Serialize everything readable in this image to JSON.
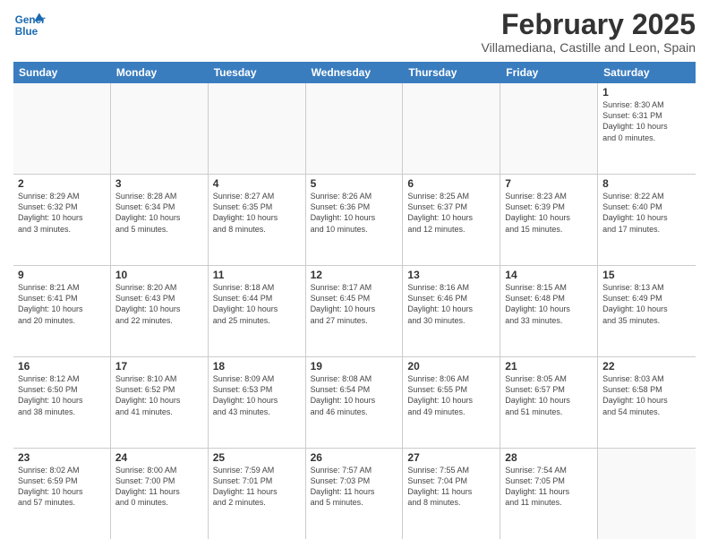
{
  "header": {
    "logo_text_general": "General",
    "logo_text_blue": "Blue",
    "month_title": "February 2025",
    "subtitle": "Villamediana, Castille and Leon, Spain"
  },
  "days_of_week": [
    "Sunday",
    "Monday",
    "Tuesday",
    "Wednesday",
    "Thursday",
    "Friday",
    "Saturday"
  ],
  "weeks": [
    [
      {
        "day": "",
        "info": ""
      },
      {
        "day": "",
        "info": ""
      },
      {
        "day": "",
        "info": ""
      },
      {
        "day": "",
        "info": ""
      },
      {
        "day": "",
        "info": ""
      },
      {
        "day": "",
        "info": ""
      },
      {
        "day": "1",
        "info": "Sunrise: 8:30 AM\nSunset: 6:31 PM\nDaylight: 10 hours\nand 0 minutes."
      }
    ],
    [
      {
        "day": "2",
        "info": "Sunrise: 8:29 AM\nSunset: 6:32 PM\nDaylight: 10 hours\nand 3 minutes."
      },
      {
        "day": "3",
        "info": "Sunrise: 8:28 AM\nSunset: 6:34 PM\nDaylight: 10 hours\nand 5 minutes."
      },
      {
        "day": "4",
        "info": "Sunrise: 8:27 AM\nSunset: 6:35 PM\nDaylight: 10 hours\nand 8 minutes."
      },
      {
        "day": "5",
        "info": "Sunrise: 8:26 AM\nSunset: 6:36 PM\nDaylight: 10 hours\nand 10 minutes."
      },
      {
        "day": "6",
        "info": "Sunrise: 8:25 AM\nSunset: 6:37 PM\nDaylight: 10 hours\nand 12 minutes."
      },
      {
        "day": "7",
        "info": "Sunrise: 8:23 AM\nSunset: 6:39 PM\nDaylight: 10 hours\nand 15 minutes."
      },
      {
        "day": "8",
        "info": "Sunrise: 8:22 AM\nSunset: 6:40 PM\nDaylight: 10 hours\nand 17 minutes."
      }
    ],
    [
      {
        "day": "9",
        "info": "Sunrise: 8:21 AM\nSunset: 6:41 PM\nDaylight: 10 hours\nand 20 minutes."
      },
      {
        "day": "10",
        "info": "Sunrise: 8:20 AM\nSunset: 6:43 PM\nDaylight: 10 hours\nand 22 minutes."
      },
      {
        "day": "11",
        "info": "Sunrise: 8:18 AM\nSunset: 6:44 PM\nDaylight: 10 hours\nand 25 minutes."
      },
      {
        "day": "12",
        "info": "Sunrise: 8:17 AM\nSunset: 6:45 PM\nDaylight: 10 hours\nand 27 minutes."
      },
      {
        "day": "13",
        "info": "Sunrise: 8:16 AM\nSunset: 6:46 PM\nDaylight: 10 hours\nand 30 minutes."
      },
      {
        "day": "14",
        "info": "Sunrise: 8:15 AM\nSunset: 6:48 PM\nDaylight: 10 hours\nand 33 minutes."
      },
      {
        "day": "15",
        "info": "Sunrise: 8:13 AM\nSunset: 6:49 PM\nDaylight: 10 hours\nand 35 minutes."
      }
    ],
    [
      {
        "day": "16",
        "info": "Sunrise: 8:12 AM\nSunset: 6:50 PM\nDaylight: 10 hours\nand 38 minutes."
      },
      {
        "day": "17",
        "info": "Sunrise: 8:10 AM\nSunset: 6:52 PM\nDaylight: 10 hours\nand 41 minutes."
      },
      {
        "day": "18",
        "info": "Sunrise: 8:09 AM\nSunset: 6:53 PM\nDaylight: 10 hours\nand 43 minutes."
      },
      {
        "day": "19",
        "info": "Sunrise: 8:08 AM\nSunset: 6:54 PM\nDaylight: 10 hours\nand 46 minutes."
      },
      {
        "day": "20",
        "info": "Sunrise: 8:06 AM\nSunset: 6:55 PM\nDaylight: 10 hours\nand 49 minutes."
      },
      {
        "day": "21",
        "info": "Sunrise: 8:05 AM\nSunset: 6:57 PM\nDaylight: 10 hours\nand 51 minutes."
      },
      {
        "day": "22",
        "info": "Sunrise: 8:03 AM\nSunset: 6:58 PM\nDaylight: 10 hours\nand 54 minutes."
      }
    ],
    [
      {
        "day": "23",
        "info": "Sunrise: 8:02 AM\nSunset: 6:59 PM\nDaylight: 10 hours\nand 57 minutes."
      },
      {
        "day": "24",
        "info": "Sunrise: 8:00 AM\nSunset: 7:00 PM\nDaylight: 11 hours\nand 0 minutes."
      },
      {
        "day": "25",
        "info": "Sunrise: 7:59 AM\nSunset: 7:01 PM\nDaylight: 11 hours\nand 2 minutes."
      },
      {
        "day": "26",
        "info": "Sunrise: 7:57 AM\nSunset: 7:03 PM\nDaylight: 11 hours\nand 5 minutes."
      },
      {
        "day": "27",
        "info": "Sunrise: 7:55 AM\nSunset: 7:04 PM\nDaylight: 11 hours\nand 8 minutes."
      },
      {
        "day": "28",
        "info": "Sunrise: 7:54 AM\nSunset: 7:05 PM\nDaylight: 11 hours\nand 11 minutes."
      },
      {
        "day": "",
        "info": ""
      }
    ]
  ]
}
